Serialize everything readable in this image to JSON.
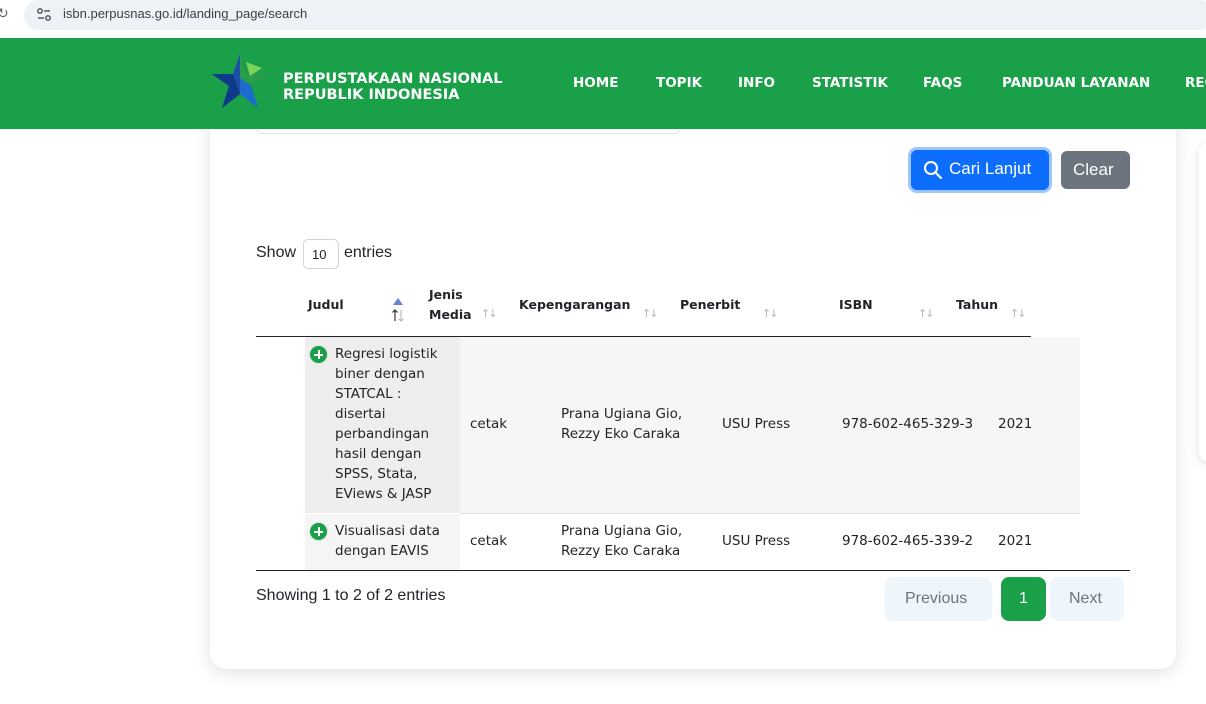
{
  "browser": {
    "url": "isbn.perpusnas.go.id/landing_page/search"
  },
  "header": {
    "brand_line1": "PERPUSTAKAAN NASIONAL",
    "brand_line2": "REPUBLIK INDONESIA",
    "nav": [
      "HOME",
      "TOPIK",
      "INFO",
      "STATISTIK",
      "FAQS",
      "PANDUAN LAYANAN",
      "REG"
    ],
    "color": "#1aa048"
  },
  "search": {
    "advanced_label": "Cari Lanjut",
    "clear_label": "Clear"
  },
  "length": {
    "show_label": "Show",
    "value": "10",
    "entries_label": "entries"
  },
  "table": {
    "columns": [
      "Judul",
      "Jenis",
      "Media",
      "Kepengarangan",
      "Penerbit",
      "ISBN",
      "Tahun"
    ],
    "rows": [
      {
        "judul_lines": [
          "Regresi logistik",
          "biner dengan",
          "STATCAL :",
          "disertai",
          "perbandingan",
          "hasil dengan",
          "SPSS, Stata,",
          "EViews & JASP"
        ],
        "media": "cetak",
        "authors": [
          "Prana Ugiana Gio,",
          "Rezzy Eko Caraka"
        ],
        "publisher": "USU Press",
        "isbn": "978-602-465-329-3",
        "year": "2021"
      },
      {
        "judul_lines": [
          "Visualisasi data",
          "dengan EAVIS"
        ],
        "media": "cetak",
        "authors": [
          "Prana Ugiana Gio,",
          "Rezzy Eko Caraka"
        ],
        "publisher": "USU Press",
        "isbn": "978-602-465-339-2",
        "year": "2021"
      }
    ]
  },
  "footer": {
    "info": "Showing 1 to 2 of 2 entries",
    "prev": "Previous",
    "current_page": "1",
    "next": "Next"
  }
}
